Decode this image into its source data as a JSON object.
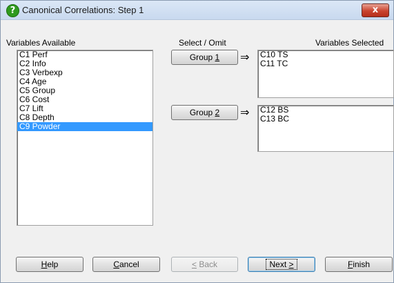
{
  "window": {
    "title": "Canonical Correlations: Step 1",
    "close_label": "x"
  },
  "labels": {
    "variables_available": "Variables Available",
    "select_omit": "Select / Omit",
    "variables_selected": "Variables Selected"
  },
  "available": [
    {
      "label": "C1 Perf",
      "selected": false
    },
    {
      "label": "C2 Info",
      "selected": false
    },
    {
      "label": "C3 Verbexp",
      "selected": false
    },
    {
      "label": "C4 Age",
      "selected": false
    },
    {
      "label": "C5 Group",
      "selected": false
    },
    {
      "label": "C6 Cost",
      "selected": false
    },
    {
      "label": "C7 Lift",
      "selected": false
    },
    {
      "label": "C8 Depth",
      "selected": false
    },
    {
      "label": "C9 Powder",
      "selected": true
    }
  ],
  "groups": [
    {
      "button_prefix": "Group ",
      "button_key": "1",
      "arrow": "⇒",
      "items": [
        "C10 TS",
        "C11 TC"
      ]
    },
    {
      "button_prefix": "Group ",
      "button_key": "2",
      "arrow": "⇒",
      "items": [
        "C12 BS",
        "C13 BC"
      ]
    }
  ],
  "footer": {
    "help": {
      "key": "H",
      "rest": "elp"
    },
    "cancel": {
      "key": "C",
      "rest": "ancel"
    },
    "back": {
      "key": "<",
      "rest": " Back"
    },
    "next": {
      "pre": "Next ",
      "key": ">"
    },
    "finish": {
      "key": "F",
      "rest": "inish"
    }
  }
}
